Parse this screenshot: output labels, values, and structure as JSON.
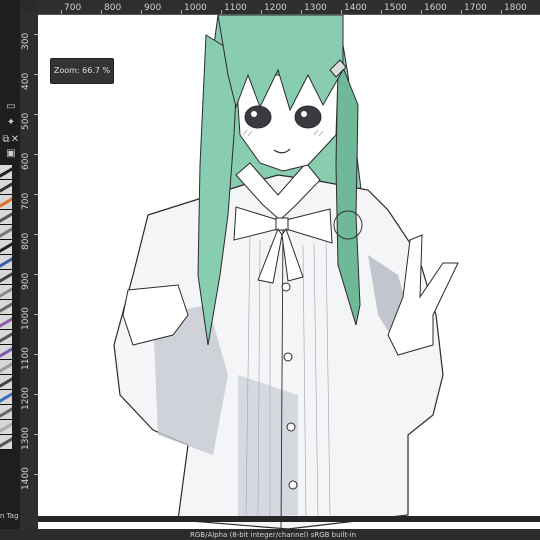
{
  "zoom_tooltip": "Zoom: 66.7 %",
  "status": {
    "color_info": "RGB/Alpha (8-bit integer/channel)  sRGB built-in"
  },
  "ruler_top": [
    "700",
    "800",
    "900",
    "1000",
    "1100",
    "1200",
    "1300",
    "1400",
    "1500",
    "1600",
    "1700",
    "1800"
  ],
  "ruler_left": [
    "300",
    "400",
    "500",
    "600",
    "700",
    "800",
    "900",
    "1000",
    "1100",
    "1200",
    "1300",
    "1400"
  ],
  "left_dock": {
    "tag_label": "n Tag"
  },
  "colors": {
    "hair": "#88cdb0",
    "hair_shade": "#6fb898",
    "shadow": "#9ea3ad",
    "line": "#2a2a30"
  },
  "icons": [
    "comment-icon",
    "pin-icon",
    "copy-icon",
    "close-icon",
    "toggle-icon"
  ]
}
